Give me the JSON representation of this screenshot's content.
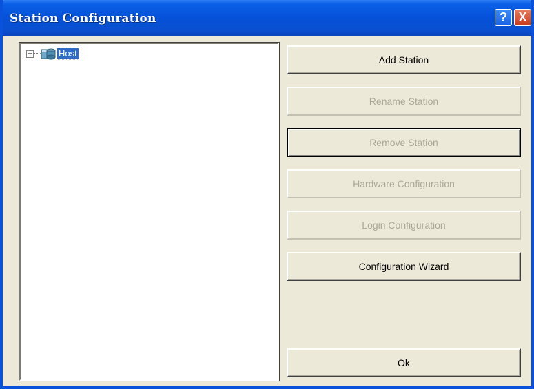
{
  "window": {
    "title": "Station Configuration",
    "help_label": "?",
    "close_label": "X"
  },
  "tree": {
    "nodes": [
      {
        "label": "Host",
        "expander": "+",
        "selected": true
      }
    ]
  },
  "buttons": {
    "add_station": "Add Station",
    "rename_station": "Rename Station",
    "remove_station": "Remove Station",
    "hardware_configuration": "Hardware Configuration",
    "login_configuration": "Login Configuration",
    "configuration_wizard": "Configuration Wizard",
    "ok": "Ok"
  },
  "colors": {
    "titlebar": "#0551d8",
    "selection": "#316ac5",
    "disabled_text": "#aca899",
    "close_button": "#c8391b"
  }
}
